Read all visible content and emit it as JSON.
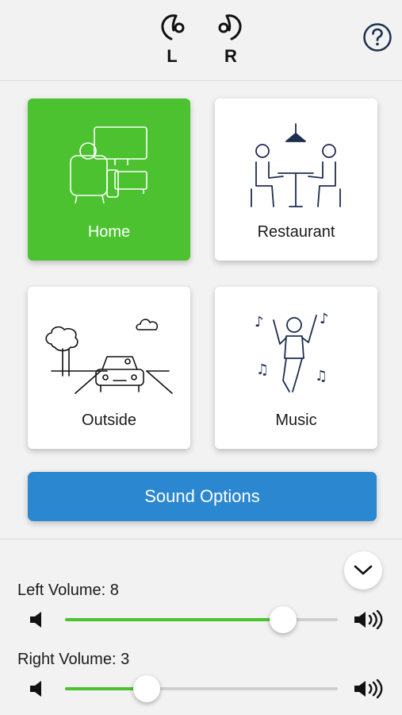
{
  "header": {
    "left_ear": {
      "label": "L",
      "icon": "left-hearing-aid-icon"
    },
    "right_ear": {
      "label": "R",
      "icon": "right-hearing-aid-icon"
    },
    "help_icon": "help-circle-icon"
  },
  "programs": [
    {
      "label": "Home",
      "icon": "home-tv-sofa-icon",
      "selected": true
    },
    {
      "label": "Restaurant",
      "icon": "restaurant-table-icon",
      "selected": false
    },
    {
      "label": "Outside",
      "icon": "car-road-icon",
      "selected": false
    },
    {
      "label": "Music",
      "icon": "dancing-person-icon",
      "selected": false
    }
  ],
  "sound_options": {
    "label": "Sound Options"
  },
  "volume": {
    "collapse_icon": "chevron-down-icon",
    "left": {
      "label": "Left Volume: 8",
      "value": 8,
      "max": 10
    },
    "right": {
      "label": "Right Volume: 3",
      "value": 3,
      "max": 10
    }
  },
  "colors": {
    "accent_green": "#4cc230",
    "button_blue": "#2b87cf",
    "icon_navy": "#1d2e4f"
  }
}
